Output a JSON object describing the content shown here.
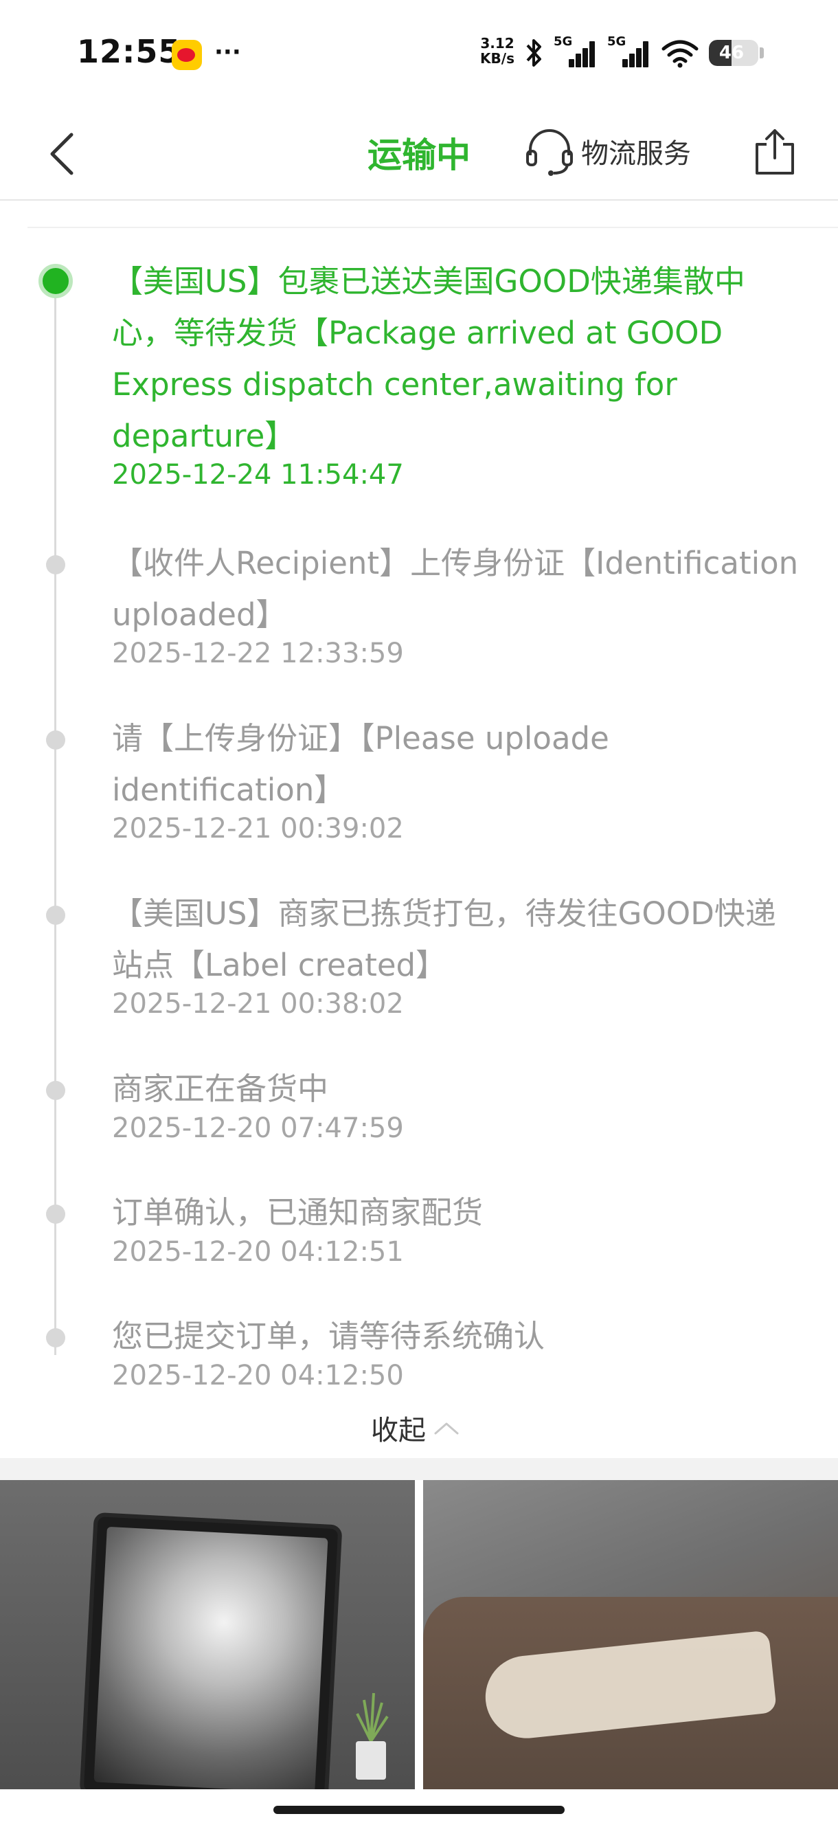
{
  "status_bar": {
    "time": "12:55",
    "more": "···",
    "net_speed_value": "3.12",
    "net_speed_unit": "KB/s",
    "sim1_label": "5G",
    "sim2_label": "5G",
    "battery_level": "46",
    "battery_fraction": 0.46
  },
  "header": {
    "title": "运输中",
    "service_label": "物流服务",
    "accent_color": "#2fb52f"
  },
  "timeline": [
    {
      "text": "【美国US】包裹已送达美国GOOD快递集散中心，等待发货【Package arrived at GOOD Express dispatch center,awaiting for departure】",
      "time": "2025-12-24 11:54:47",
      "current": true
    },
    {
      "text": "【收件人Recipient】上传身份证【Identification uploaded】",
      "time": "2025-12-22 12:33:59",
      "current": false
    },
    {
      "text": "请【上传身份证】【Please uploade identification】",
      "time": "2025-12-21 00:39:02",
      "current": false
    },
    {
      "text": "【美国US】商家已拣货打包，待发往GOOD快递站点【Label created】",
      "time": "2025-12-21 00:38:02",
      "current": false
    },
    {
      "text": "商家正在备货中",
      "time": "2025-12-20 07:47:59",
      "current": false
    },
    {
      "text": "订单确认，已通知商家配货",
      "time": "2025-12-20 04:12:51",
      "current": false
    },
    {
      "text": "您已提交订单，请等待系统确认",
      "time": "2025-12-20 04:12:50",
      "current": false
    }
  ],
  "collapse_label": "收起"
}
